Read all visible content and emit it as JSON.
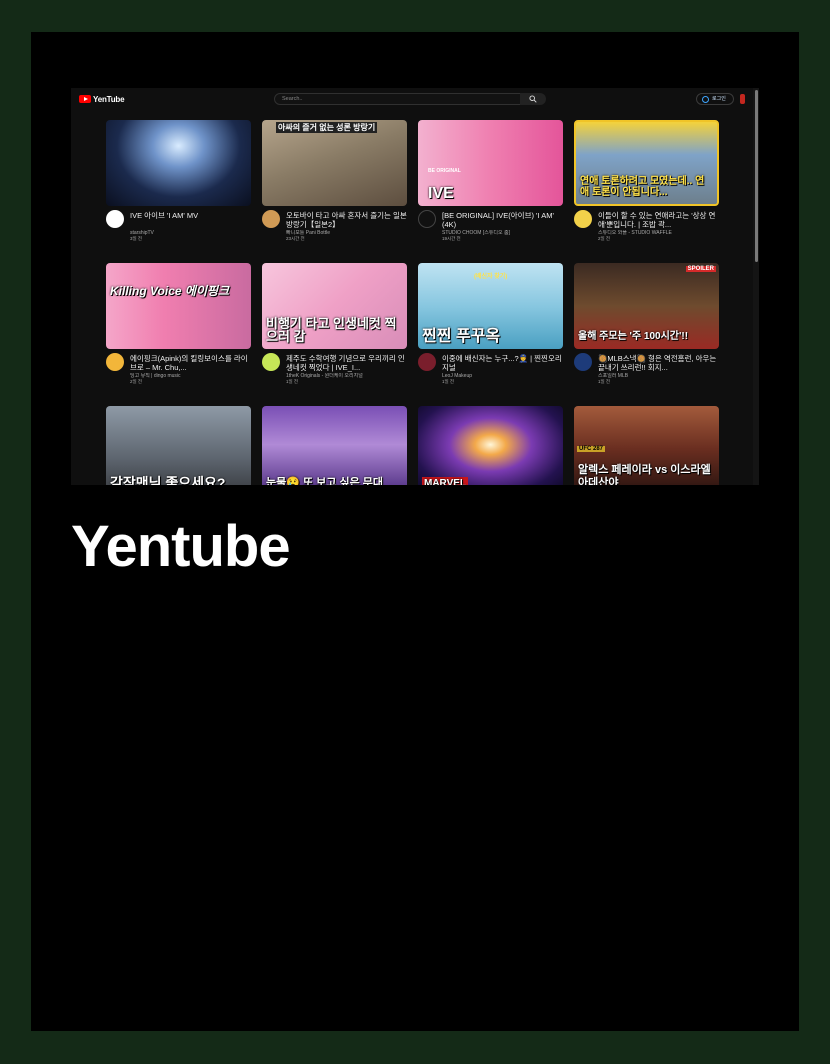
{
  "heading": "Yentube",
  "app": {
    "logo_text": "YenTube",
    "search_placeholder": "Search..",
    "login_label": "로그인"
  },
  "colors": {
    "outer_background": "#142a17",
    "card_background": "#000000",
    "accent": "#ff0000",
    "link": "#3ea6ff"
  },
  "icons": [
    "logo-play-icon",
    "search-icon",
    "user-icon"
  ],
  "videos": [
    {
      "title": "IVE 아이브 'I AM' MV",
      "channel": "starshipTV",
      "meta": "3일 전",
      "thumb_text": "",
      "thumb_tag": ""
    },
    {
      "title": "오토바이 타고 아싸 혼자서 즐기는 일본 방랑기【일본2】",
      "channel": "빠니보틀 Pani Bottle",
      "meta": "23시간 전",
      "thumb_text": "아싸의 즐거 없는 성론 방랑기",
      "thumb_tag": ""
    },
    {
      "title": "[BE ORIGINAL] IVE(아이브) 'I AM' (4K)",
      "channel": "STUDIO CHOOM [스튜디오 춤]",
      "meta": "19시간 전",
      "thumb_text": "IVE",
      "thumb_tag": "BE ORIGINAL"
    },
    {
      "title": "이들이 할 수 있는 연애라고는 '상상 연애'뿐입니다. | 조밥 곽...",
      "channel": "스튜디오 와플 - STUDIO WAFFLE",
      "meta": "2일 전",
      "thumb_text": "연애 토론하려고 모였는데.. 연애 토론이 안됩니다...",
      "thumb_tag": ""
    },
    {
      "title": "에이핑크(Apink)의 킬링보이스를 라이브로 – Mr. Chu,...",
      "channel": "딩고 뮤직 | dingo music",
      "meta": "2일 전",
      "thumb_text": "Killing Voice 에이핑크",
      "thumb_tag": ""
    },
    {
      "title": "제주도 수학여행 기념으로 우리끼리 인생네컷 찍었다 | IVE_I...",
      "channel": "1theK Originals - 원더케이 오리지널",
      "meta": "1일 전",
      "thumb_text": "비행기 타고 인생네컷 찍으러 감",
      "thumb_tag": ""
    },
    {
      "title": "이중에 배신자는 누구...?👮 | 찐찐오리지널",
      "channel": "LeoJ Makeup",
      "meta": "1일 전",
      "thumb_text": "찐찐 푸꾸옥",
      "thumb_tag": "(배신자 찾기)"
    },
    {
      "title": "🥘MLB스낵🥘 형은 역전홈런, 아우는 끝내기 쓰리런!! 회지...",
      "channel": "스포일러 MLB",
      "meta": "1일 전",
      "thumb_text": "올해 주모는 '주 100시간'!!",
      "thumb_tag": "SPOILER"
    },
    {
      "title": "",
      "channel": "",
      "meta": "",
      "thumb_text": "감작맨님 좋으세요?",
      "thumb_tag": ""
    },
    {
      "title": "",
      "channel": "",
      "meta": "",
      "thumb_text": "눈물😢 또 보고 싶은 무대",
      "thumb_tag": ""
    },
    {
      "title": "",
      "channel": "",
      "meta": "",
      "thumb_text": "MARVEL",
      "thumb_tag": ""
    },
    {
      "title": "",
      "channel": "",
      "meta": "",
      "thumb_text": "알렉스 페레이라 vs 이스라엘 아데산야",
      "thumb_tag": "UFC 287"
    }
  ]
}
